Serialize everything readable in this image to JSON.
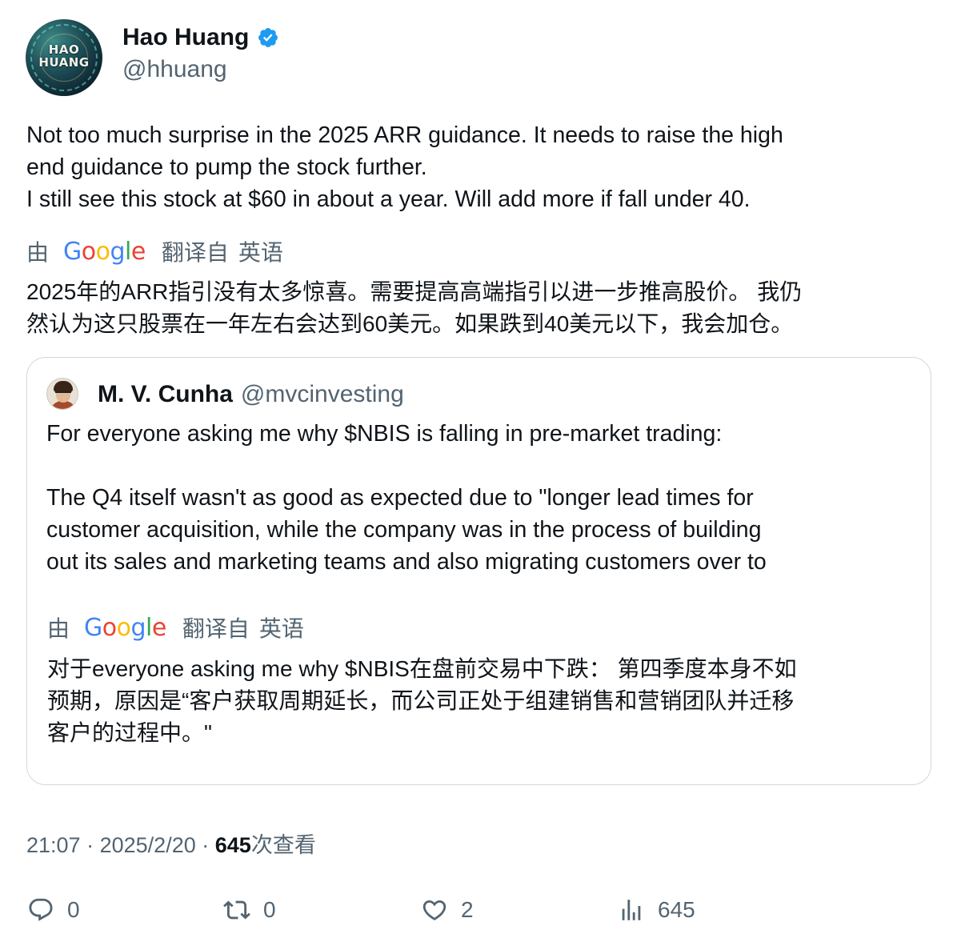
{
  "author": {
    "display_name": "Hao Huang",
    "handle": "@hhuang",
    "avatar_text_line1": "HAO",
    "avatar_text_line2": "HUANG",
    "verified": true
  },
  "tweet": {
    "text_lines": [
      "Not too much surprise in the 2025 ARR guidance. It needs to raise the high",
      "end guidance to pump the stock further.",
      "I still see this stock at $60 in about a year. Will add more if fall under 40."
    ],
    "translation": {
      "by_label": "由",
      "provider": "Google",
      "from_label": "翻译自",
      "language": "英语",
      "lines": [
        "2025年的ARR指引没有太多惊喜。需要提高高端指引以进一步推高股价。 我仍",
        "然认为这只股票在一年左右会达到60美元。如果跌到40美元以下，我会加仓。"
      ]
    }
  },
  "quoted_tweet": {
    "display_name": "M. V. Cunha",
    "handle": "@mvcinvesting",
    "text_lines": [
      "For everyone asking me why $NBIS is falling in pre-market trading:",
      "",
      "The Q4 itself wasn't as good as expected due to \"longer lead times for",
      "customer acquisition, while the company was in the process of building",
      "out its sales and marketing teams and also migrating customers over to"
    ],
    "translation": {
      "by_label": "由",
      "provider": "Google",
      "from_label": "翻译自",
      "language": "英语",
      "lines": [
        "对于everyone asking me why $NBIS在盘前交易中下跌： 第四季度本身不如",
        "预期，原因是“客户获取周期延长，而公司正处于组建销售和营销团队并迁移",
        "客户的过程中。\""
      ]
    }
  },
  "meta": {
    "time": "21:07",
    "separator": "·",
    "date": "2025/2/20",
    "views_count": "645",
    "views_label": "次查看"
  },
  "actions": {
    "reply_count": "0",
    "retweet_count": "0",
    "like_count": "2",
    "views_count": "645"
  },
  "colors": {
    "verified_blue": "#1d9bf0",
    "secondary_text": "#536471",
    "primary_text": "#0f1419",
    "border": "#cfd9de"
  }
}
